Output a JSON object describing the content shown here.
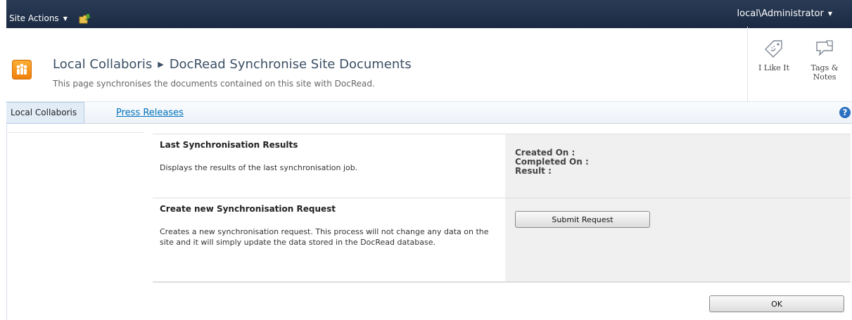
{
  "topbar": {
    "site_actions_label": "Site Actions",
    "user_label": "local\\Administrator"
  },
  "title": {
    "site_name": "Local Collaboris",
    "page_name": "DocRead Synchronise Site Documents",
    "description": "This page synchronises the documents contained on this site with DocRead."
  },
  "social": {
    "like_label": "I Like It",
    "tags_label_line1": "Tags &",
    "tags_label_line2": "Notes"
  },
  "nav": {
    "current": "Local Collaboris",
    "links": [
      "Press Releases"
    ]
  },
  "sections": {
    "last_results": {
      "title": "Last Synchronisation Results",
      "description": "Displays the results of the last synchronisation job.",
      "created_on_label": "Created On :",
      "completed_on_label": "Completed On :",
      "result_label": "Result :"
    },
    "new_request": {
      "title": "Create new Synchronisation Request",
      "description": "Creates a new synchronisation request. This process will not change any data on the site and it will simply update the data stored in the DocRead database.",
      "submit_label": "Submit Request"
    }
  },
  "ok_label": "OK",
  "colors": {
    "topbar": "#1f2f47",
    "link": "#0072bc",
    "logo": "#f39318"
  }
}
